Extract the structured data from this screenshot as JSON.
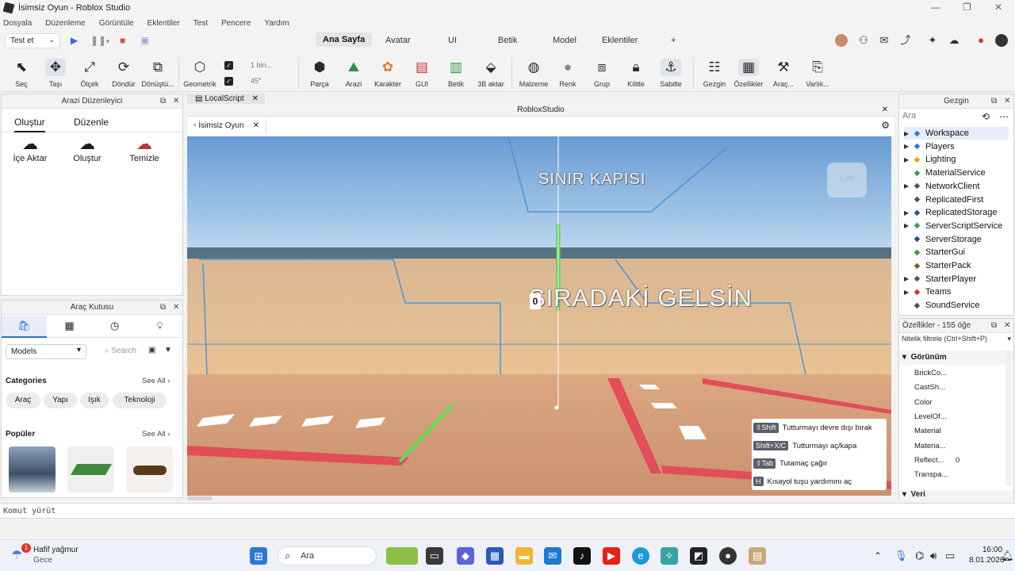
{
  "window": {
    "title": "İsimsiz Oyun - Roblox Studio"
  },
  "menu": [
    "Dosyala",
    "Düzenleme",
    "Görüntüle",
    "Eklentiler",
    "Test",
    "Pencere",
    "Yardım"
  ],
  "toolbar": {
    "test_dropdown": "Test et",
    "ribbon_tabs": [
      "Ana Sayfa",
      "Avatar",
      "UI",
      "Betik",
      "Model",
      "Eklentiler",
      "+"
    ],
    "tools": [
      {
        "label": "Seç",
        "icon": "cursor-icon"
      },
      {
        "label": "Taşı",
        "icon": "move-icon"
      },
      {
        "label": "Ölçek",
        "icon": "scale-icon"
      },
      {
        "label": "Döndür",
        "icon": "rotate-icon"
      },
      {
        "label": "Dönüştü...",
        "icon": "transform-icon"
      },
      {
        "label": "Geometrik",
        "icon": "geometry-icon"
      },
      {
        "label": "Parça",
        "icon": "part-icon"
      },
      {
        "label": "Arazi",
        "icon": "terrain-icon"
      },
      {
        "label": "Karakter",
        "icon": "character-icon"
      },
      {
        "label": "GUI",
        "icon": "gui-icon"
      },
      {
        "label": "Betik",
        "icon": "script-icon"
      },
      {
        "label": "3B aktar",
        "icon": "import-3d-icon"
      },
      {
        "label": "Malzeme",
        "icon": "material-icon"
      },
      {
        "label": "Renk",
        "icon": "color-icon"
      },
      {
        "label": "Grup",
        "icon": "group-icon"
      },
      {
        "label": "Kilitle",
        "icon": "lock-icon"
      },
      {
        "label": "Sabitle",
        "icon": "anchor-icon"
      },
      {
        "label": "Gezgin",
        "icon": "explorer-icon"
      },
      {
        "label": "Özellikler",
        "icon": "properties-icon"
      },
      {
        "label": "Araç...",
        "icon": "toolbox-icon"
      },
      {
        "label": "Varlık...",
        "icon": "asset-icon"
      }
    ],
    "move_increment": "1 biri...",
    "rotate_increment": "45°"
  },
  "terrain_editor": {
    "title": "Arazi Düzenleyici",
    "tabs": [
      "Oluştur",
      "Düzenle"
    ],
    "actions": [
      {
        "label": "İçe Aktar",
        "icon": "import-cloud-icon"
      },
      {
        "label": "Oluştur",
        "icon": "generate-cloud-icon"
      },
      {
        "label": "Temizle",
        "icon": "clear-cloud-icon"
      }
    ]
  },
  "toolbox": {
    "title": "Araç Kutusu",
    "dropdown": "Models",
    "search_placeholder": "Search",
    "categories_label": "Categories",
    "see_all": "See All",
    "categories": [
      "Araç",
      "Yapı",
      "Işık",
      "Teknoloji"
    ],
    "popular_label": "Popüler",
    "popular_see_all": "See All"
  },
  "doc_tabs": {
    "script_tab": "LocalScript",
    "window_title": "RobloxStudio",
    "game_tab": "İsimsiz Oyun"
  },
  "viewport": {
    "sign_top": "SINIR KAPISI",
    "sign_main": "SIRADAKİ GELSİN",
    "counter": "0",
    "view_cube": "Left",
    "hints": [
      {
        "key": "⇧Shift",
        "text": "Tutturmayı devre dışı bırak"
      },
      {
        "key": "Shift+X/C",
        "text": "Tutturmayı aç/kapa"
      },
      {
        "key": "⇧Tab",
        "text": "Tutamaç çağır"
      },
      {
        "key": "H",
        "text": "Kısayol tuşu yardımını aç"
      }
    ]
  },
  "explorer": {
    "title": "Gezgin",
    "search_placeholder": "Ara",
    "items": [
      {
        "label": "Workspace",
        "icon": "workspace-icon",
        "expandable": true
      },
      {
        "label": "Players",
        "icon": "players-icon",
        "expandable": true
      },
      {
        "label": "Lighting",
        "icon": "lighting-icon",
        "expandable": true
      },
      {
        "label": "MaterialService",
        "icon": "material-service-icon",
        "expandable": false
      },
      {
        "label": "NetworkClient",
        "icon": "network-client-icon",
        "expandable": true
      },
      {
        "label": "ReplicatedFirst",
        "icon": "replicated-first-icon",
        "expandable": false
      },
      {
        "label": "ReplicatedStorage",
        "icon": "replicated-storage-icon",
        "expandable": true
      },
      {
        "label": "ServerScriptService",
        "icon": "server-script-service-icon",
        "expandable": true
      },
      {
        "label": "ServerStorage",
        "icon": "server-storage-icon",
        "expandable": false
      },
      {
        "label": "StarterGui",
        "icon": "starter-gui-icon",
        "expandable": false
      },
      {
        "label": "StarterPack",
        "icon": "starter-pack-icon",
        "expandable": false
      },
      {
        "label": "StarterPlayer",
        "icon": "starter-player-icon",
        "expandable": true
      },
      {
        "label": "Teams",
        "icon": "teams-icon",
        "expandable": true
      },
      {
        "label": "SoundService",
        "icon": "sound-service-icon",
        "expandable": false
      }
    ]
  },
  "properties": {
    "title": "Özellikler - 155 öğe",
    "filter_placeholder": "Nitelik filtrele (Ctrl+Shift+P)",
    "section": "Görünüm",
    "rows": [
      {
        "name": "BrickCo...",
        "value": ""
      },
      {
        "name": "CastSh...",
        "value": ""
      },
      {
        "name": "Color",
        "value": ""
      },
      {
        "name": "LevelOf...",
        "value": ""
      },
      {
        "name": "Material",
        "value": ""
      },
      {
        "name": "Materia...",
        "value": ""
      },
      {
        "name": "Reflect...",
        "value": "0"
      },
      {
        "name": "Transpa...",
        "value": ""
      }
    ],
    "section2": "Veri"
  },
  "command_bar": {
    "placeholder": "Komut yürüt"
  },
  "taskbar": {
    "weather_title": "Hafif yağmur",
    "weather_sub": "Gece",
    "weather_badge": "1",
    "search": "Ara",
    "time": "16:00",
    "date": "8.01.2026"
  }
}
